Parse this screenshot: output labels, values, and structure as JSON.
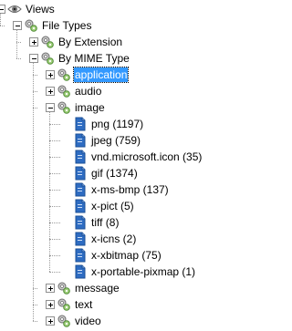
{
  "tree": {
    "nodes": [
      {
        "label": "Views",
        "icon": "eye-icon",
        "level": 0,
        "toggle": "minus"
      },
      {
        "label": "File Types",
        "icon": "settings-node-icon",
        "level": 1,
        "toggle": "minus"
      },
      {
        "label": "By Extension",
        "icon": "settings-node-icon",
        "level": 2,
        "toggle": "plus"
      },
      {
        "label": "By MIME Type",
        "icon": "settings-node-icon",
        "level": 2,
        "toggle": "minus"
      },
      {
        "label": "application",
        "icon": "settings-node-icon",
        "level": 3,
        "toggle": "plus",
        "selected": true
      },
      {
        "label": "audio",
        "icon": "settings-node-icon",
        "level": 3,
        "toggle": "plus"
      },
      {
        "label": "image",
        "icon": "settings-node-icon",
        "level": 3,
        "toggle": "minus"
      },
      {
        "label": "png (1197)",
        "icon": "file-type-icon",
        "level": 4
      },
      {
        "label": "jpeg (759)",
        "icon": "file-type-icon",
        "level": 4
      },
      {
        "label": "vnd.microsoft.icon (35)",
        "icon": "file-type-icon",
        "level": 4
      },
      {
        "label": "gif (1374)",
        "icon": "file-type-icon",
        "level": 4
      },
      {
        "label": "x-ms-bmp (137)",
        "icon": "file-type-icon",
        "level": 4
      },
      {
        "label": "x-pict (5)",
        "icon": "file-type-icon",
        "level": 4
      },
      {
        "label": "tiff (8)",
        "icon": "file-type-icon",
        "level": 4
      },
      {
        "label": "x-icns (2)",
        "icon": "file-type-icon",
        "level": 4
      },
      {
        "label": "x-xbitmap (75)",
        "icon": "file-type-icon",
        "level": 4
      },
      {
        "label": "x-portable-pixmap (1)",
        "icon": "file-type-icon",
        "level": 4
      },
      {
        "label": "message",
        "icon": "settings-node-icon",
        "level": 3,
        "toggle": "plus"
      },
      {
        "label": "text",
        "icon": "settings-node-icon",
        "level": 3,
        "toggle": "plus"
      },
      {
        "label": "video",
        "icon": "settings-node-icon",
        "level": 3,
        "toggle": "plus"
      }
    ]
  },
  "colors": {
    "selection": "#3399ff",
    "file_icon": "#2e6cc2"
  }
}
